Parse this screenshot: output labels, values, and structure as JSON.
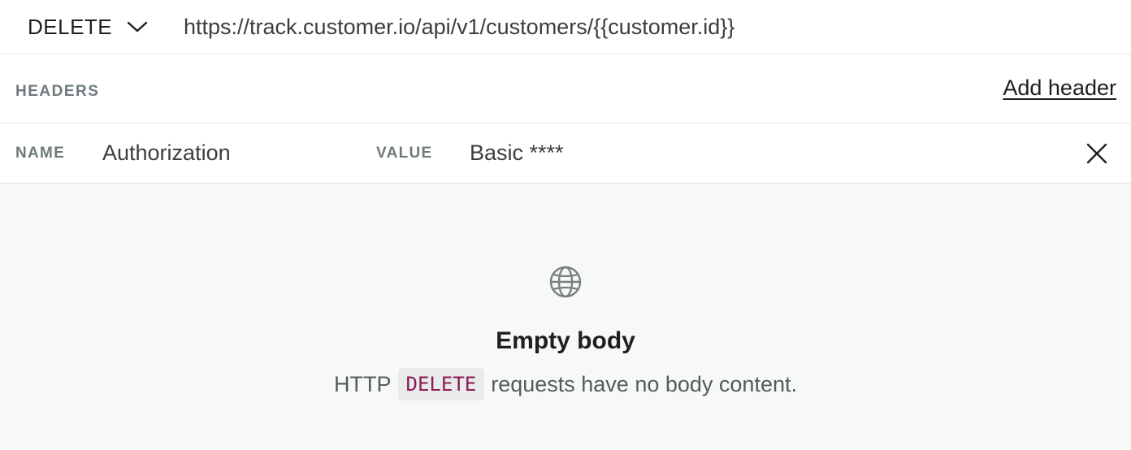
{
  "request": {
    "method": "DELETE",
    "url": "https://track.customer.io/api/v1/customers/{{customer.id}}"
  },
  "headers": {
    "title": "HEADERS",
    "add_label": "Add header",
    "name_label": "NAME",
    "value_label": "VALUE",
    "items": [
      {
        "name": "Authorization",
        "value": "Basic ****"
      }
    ]
  },
  "body": {
    "icon": "globe-icon",
    "title": "Empty body",
    "desc_prefix": "HTTP",
    "desc_code": "DELETE",
    "desc_suffix": "requests have no body content."
  },
  "colors": {
    "code_text": "#8c1a55",
    "code_bg": "#e9eaea",
    "body_bg": "#f7f8f8",
    "label": "#6e7a7c"
  }
}
